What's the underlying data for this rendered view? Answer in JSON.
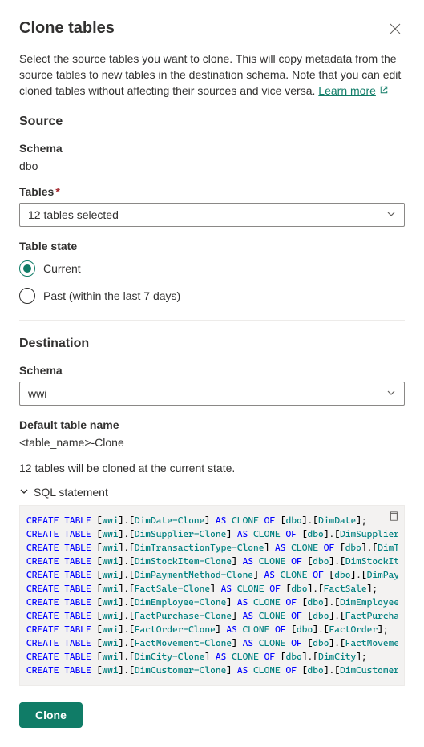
{
  "header": {
    "title": "Clone tables"
  },
  "description": {
    "text": "Select the source tables you want to clone. This will copy metadata from the source tables to new tables in the destination schema. Note that you can edit cloned tables without affecting their sources and vice versa.",
    "learn_more": "Learn more"
  },
  "source": {
    "title": "Source",
    "schema_label": "Schema",
    "schema_value": "dbo",
    "tables_label": "Tables",
    "tables_selected": "12 tables selected",
    "table_state_label": "Table state",
    "radio_current": "Current",
    "radio_past": "Past (within the last 7 days)"
  },
  "destination": {
    "title": "Destination",
    "schema_label": "Schema",
    "schema_value": "wwi",
    "default_name_label": "Default table name",
    "default_name_value": "<table_name>-Clone"
  },
  "status_text": "12 tables will be cloned at the current state.",
  "sql_section": {
    "label": "SQL statement",
    "statements": [
      {
        "dest_schema": "wwi",
        "dest_table": "DimDate-Clone",
        "src_schema": "dbo",
        "src_table": "DimDate"
      },
      {
        "dest_schema": "wwi",
        "dest_table": "DimSupplier-Clone",
        "src_schema": "dbo",
        "src_table": "DimSupplier"
      },
      {
        "dest_schema": "wwi",
        "dest_table": "DimTransactionType-Clone",
        "src_schema": "dbo",
        "src_table": "DimTra"
      },
      {
        "dest_schema": "wwi",
        "dest_table": "DimStockItem-Clone",
        "src_schema": "dbo",
        "src_table": "DimStockItem"
      },
      {
        "dest_schema": "wwi",
        "dest_table": "DimPaymentMethod-Clone",
        "src_schema": "dbo",
        "src_table": "DimPayme"
      },
      {
        "dest_schema": "wwi",
        "dest_table": "FactSale-Clone",
        "src_schema": "dbo",
        "src_table": "FactSale"
      },
      {
        "dest_schema": "wwi",
        "dest_table": "DimEmployee-Clone",
        "src_schema": "dbo",
        "src_table": "DimEmployee"
      },
      {
        "dest_schema": "wwi",
        "dest_table": "FactPurchase-Clone",
        "src_schema": "dbo",
        "src_table": "FactPurchase"
      },
      {
        "dest_schema": "wwi",
        "dest_table": "FactOrder-Clone",
        "src_schema": "dbo",
        "src_table": "FactOrder"
      },
      {
        "dest_schema": "wwi",
        "dest_table": "FactMovement-Clone",
        "src_schema": "dbo",
        "src_table": "FactMovement"
      },
      {
        "dest_schema": "wwi",
        "dest_table": "DimCity-Clone",
        "src_schema": "dbo",
        "src_table": "DimCity"
      },
      {
        "dest_schema": "wwi",
        "dest_table": "DimCustomer-Clone",
        "src_schema": "dbo",
        "src_table": "DimCustomer"
      }
    ]
  },
  "clone_button": "Clone"
}
